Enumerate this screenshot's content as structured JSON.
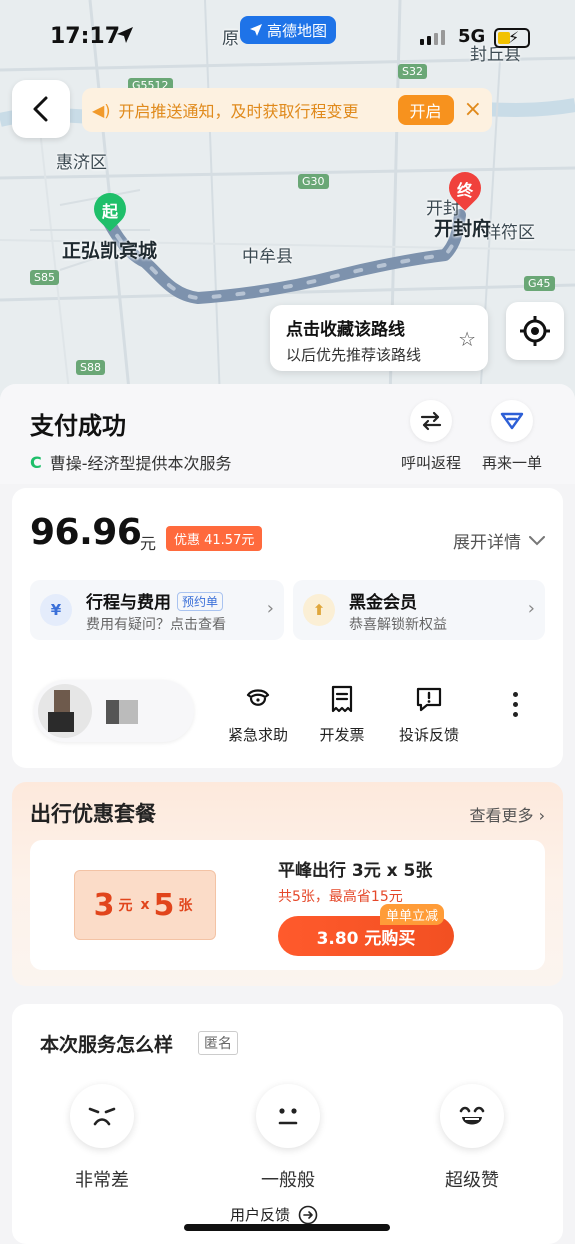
{
  "status_bar": {
    "time": "17:17",
    "map_app_badge": "高德地图",
    "network": "5G"
  },
  "map": {
    "labels": {
      "huiji": "惠济区",
      "zhongmou": "中牟县",
      "xiangfu": "祥符区",
      "fengqiu": "封丘县",
      "yuan": "原",
      "kai": "开封"
    },
    "road_badges": {
      "g5512": "G5512",
      "s32": "S32",
      "g30": "G30",
      "s85": "S85",
      "g45": "G45",
      "s88": "S88"
    },
    "start_label": "正弘凯宾城",
    "start_pin": "起",
    "end_label": "开封府",
    "end_pin": "终"
  },
  "notification": {
    "text": "开启推送通知，及时获取行程变更",
    "open_label": "开启"
  },
  "collect_route": {
    "title": "点击收藏该路线",
    "subtitle": "以后优先推荐该路线"
  },
  "header": {
    "title": "支付成功",
    "service_text": "曹操-经济型提供本次服务",
    "return_trip_label": "呼叫返程",
    "reorder_label": "再来一单"
  },
  "fare": {
    "amount": "96.96",
    "unit": "元",
    "discount": "优惠 41.57元",
    "expand_label": "展开详情",
    "trip_fee": {
      "title": "行程与费用",
      "tag": "预约单",
      "subtitle": "费用有疑问？点击查看"
    },
    "member": {
      "title": "黑金会员",
      "subtitle": "恭喜解锁新权益"
    }
  },
  "tools": {
    "emergency": "紧急求助",
    "invoice": "开发票",
    "complaint": "投诉反馈"
  },
  "promo": {
    "title": "出行优惠套餐",
    "more": "查看更多",
    "coupon_value": "3",
    "coupon_unit": "元",
    "coupon_x": "x",
    "coupon_count": "5",
    "coupon_count_unit": "张",
    "name": "平峰出行 3元 x 5张",
    "sub": "共5张，最高省15元",
    "tag": "单单立减",
    "buy_label": "3.80 元购买"
  },
  "rating": {
    "title": "本次服务怎么样",
    "anonymous": "匿名",
    "bad": "非常差",
    "neutral": "一般般",
    "great": "超级赞",
    "feedback": "用户反馈"
  },
  "colors": {
    "accent_orange": "#f25022",
    "notify_orange": "#f7921e",
    "route_blue": "#7d92ad",
    "start_green": "#1fbf6a",
    "end_red": "#f0413c"
  }
}
